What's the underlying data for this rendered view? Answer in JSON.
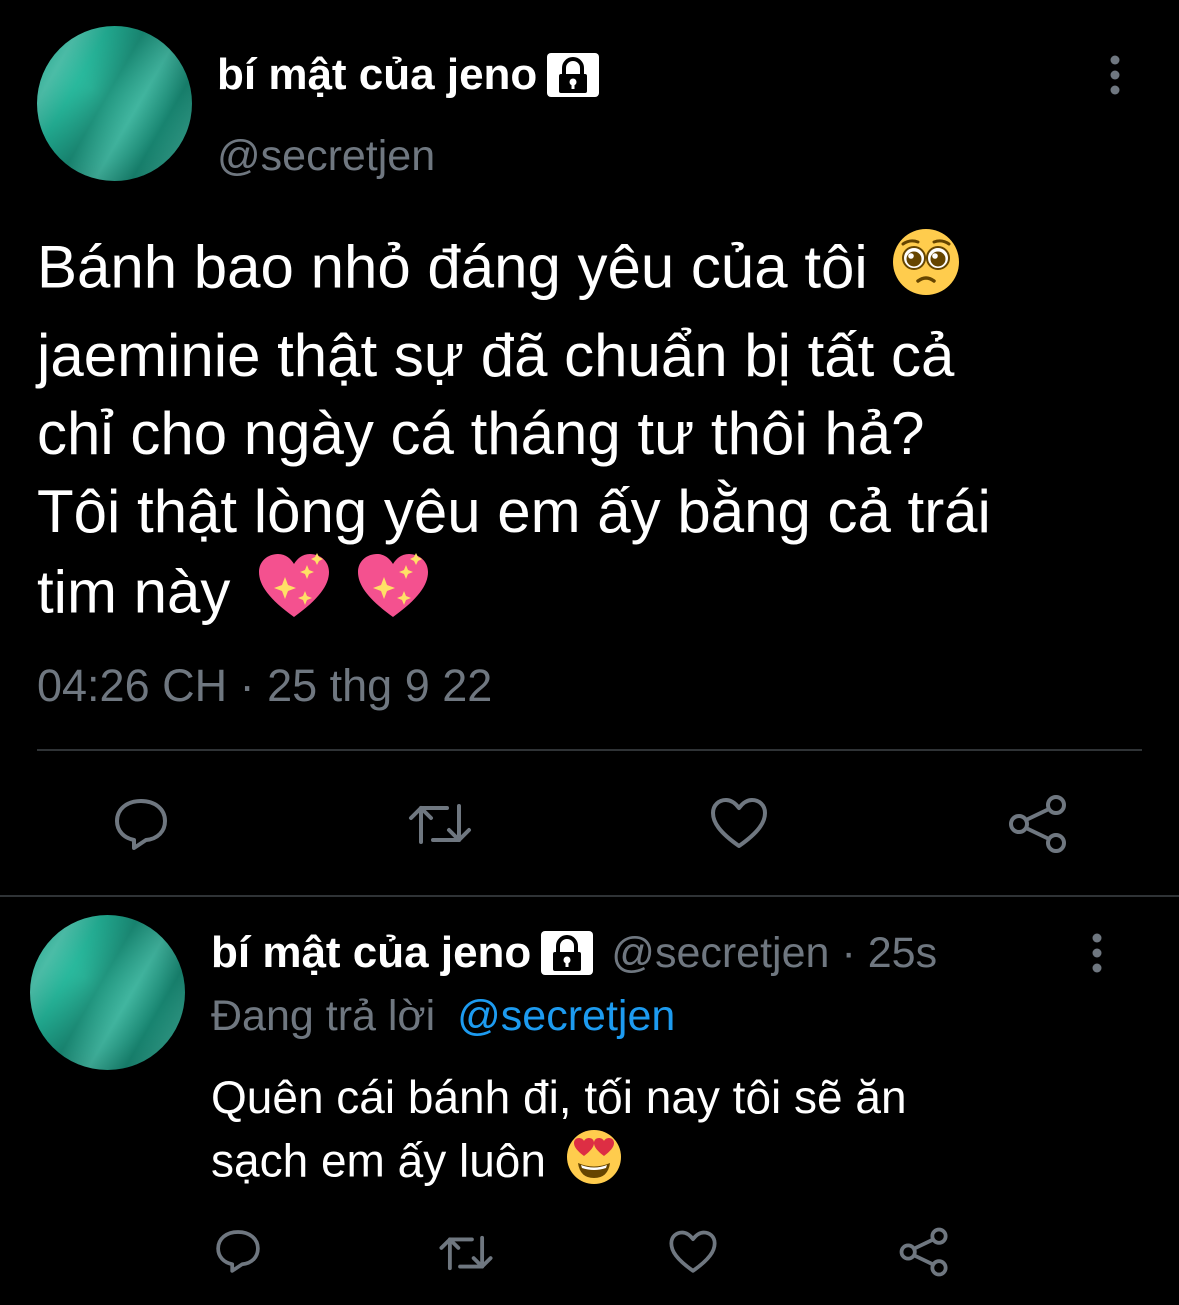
{
  "main_tweet": {
    "display_name": "bí mật của jeno",
    "handle": "@secretjen",
    "text_lines": [
      "Bánh bao nhỏ đáng yêu của tôi",
      "jaeminie thật sự đã chuẩn bị tất cả",
      "chỉ cho ngày cá tháng tư thôi hả?",
      "Tôi thật lòng yêu em ấy bằng cả trái",
      "tim này"
    ],
    "emojis": [
      "pleading-face",
      "sparkling-heart",
      "sparkling-heart"
    ],
    "timestamp": "04:26 CH · 25 thg 9 22",
    "actions": [
      "reply",
      "retweet",
      "like",
      "share"
    ]
  },
  "reply_tweet": {
    "display_name": "bí mật của jeno",
    "handle": "@secretjen",
    "separator": "·",
    "age": "25s",
    "replying_to_label": "Đang trả lời",
    "replying_to_handle": "@secretjen",
    "text_lines": [
      "Quên cái bánh đi, tối nay tôi sẽ ăn",
      "sạch em ấy luôn"
    ],
    "emojis": [
      "smiling-face-with-heart-eyes"
    ],
    "actions": [
      "reply",
      "retweet",
      "like",
      "share"
    ]
  },
  "colors": {
    "background": "#000000",
    "text": "#ffffff",
    "muted": "#6f7780",
    "link": "#1d9bf0",
    "divider": "#2f3336",
    "avatar": "#1d9e86"
  }
}
